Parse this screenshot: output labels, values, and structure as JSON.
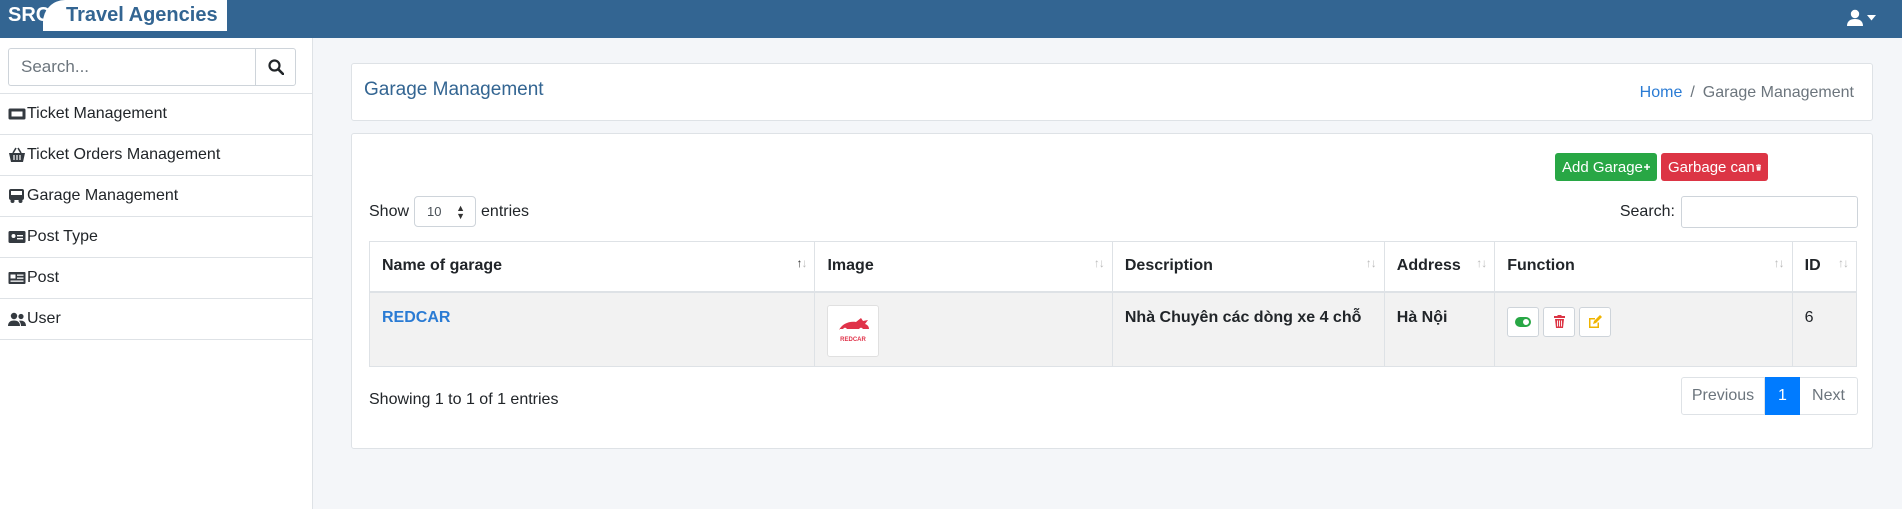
{
  "brand": {
    "short": "SRC",
    "name": "Travel Agencies"
  },
  "sidebar": {
    "search_placeholder": "Search...",
    "items": [
      {
        "label": "Ticket Management",
        "icon": "ticket-icon"
      },
      {
        "label": "Ticket Orders Management",
        "icon": "basket-icon"
      },
      {
        "label": "Garage Management",
        "icon": "bus-icon"
      },
      {
        "label": "Post Type",
        "icon": "id-card-icon"
      },
      {
        "label": "Post",
        "icon": "newspaper-icon"
      },
      {
        "label": "User",
        "icon": "users-icon"
      }
    ]
  },
  "header": {
    "title": "Garage Management",
    "breadcrumb": {
      "home": "Home",
      "separator": "/",
      "current": "Garage Management"
    }
  },
  "toolbar": {
    "add_label": "Add Garage",
    "garbage_label": "Garbage can"
  },
  "table_controls": {
    "show_label": "Show",
    "page_size": "10",
    "entries_label": "entries",
    "search_label": "Search:"
  },
  "table": {
    "columns": [
      "Name of garage",
      "Image",
      "Description",
      "Address",
      "Function",
      "ID"
    ],
    "rows": [
      {
        "name": "REDCAR",
        "image_text": "REDCAR",
        "description": "Nhà Chuyên các dòng xe 4 chỗ",
        "address": "Hà Nội",
        "id": "6"
      }
    ]
  },
  "footer": {
    "info": "Showing 1 to 1 of 1 entries",
    "previous": "Previous",
    "page": "1",
    "next": "Next"
  },
  "colors": {
    "navbar": "#336592",
    "add": "#28a745",
    "garbage": "#dc3545",
    "active_page": "#007bff",
    "link": "#2a7bd4"
  }
}
